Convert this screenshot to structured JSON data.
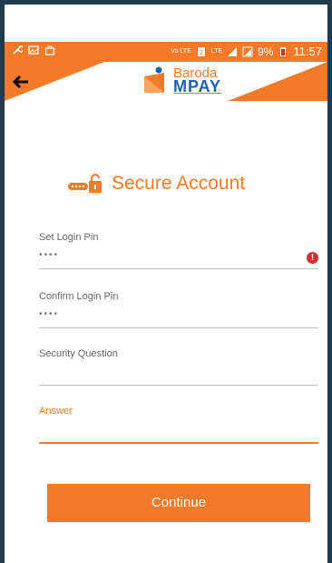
{
  "status_bar": {
    "time": "11:57",
    "battery": "9%",
    "network_labels": [
      "Vo LTE",
      "LTE"
    ]
  },
  "app_bar": {
    "back_icon": "arrow-left-icon",
    "logo_line1": "Baroda",
    "logo_line2": "MPAY"
  },
  "page": {
    "title": "Secure Account",
    "title_icon": "key-lock-icon"
  },
  "form": {
    "login_pin_label": "Set Login Pin",
    "login_pin_value": "••••",
    "login_pin_error_icon": "error-icon",
    "confirm_pin_label": "Confirm Login Pin",
    "confirm_pin_value": "••••",
    "security_question_label": "Security Question",
    "security_question_value": "",
    "answer_label": "Answer",
    "answer_value": ""
  },
  "actions": {
    "continue_label": "Continue"
  },
  "colors": {
    "accent": "#f37a28",
    "brand_blue": "#1f5fb0",
    "error": "#d32f2f",
    "frame": "#1f3b4d"
  }
}
